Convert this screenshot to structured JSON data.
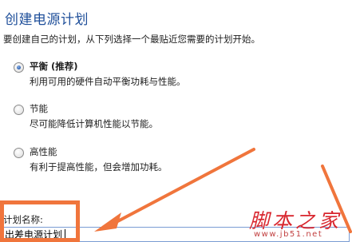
{
  "dialog": {
    "title": "创建电源计划",
    "subtitle": "要创建自己的计划，从下列选择一个最贴近您需要的计划开始。"
  },
  "plans": [
    {
      "name": "平衡 (推荐)",
      "description": "利用可用的硬件自动平衡功耗与性能。",
      "selected": true
    },
    {
      "name": "节能",
      "description": "尽可能降低计算机性能以节能。",
      "selected": false
    },
    {
      "name": "高性能",
      "description": "有利于提高性能，但会增加功耗。",
      "selected": false
    }
  ],
  "plan_name_field": {
    "label": "计划名称:",
    "value": "出差电源计划"
  },
  "annotation": {
    "color": "#f0753c"
  },
  "watermark": {
    "text": "脚本之家",
    "url": "www.jb51.net"
  }
}
